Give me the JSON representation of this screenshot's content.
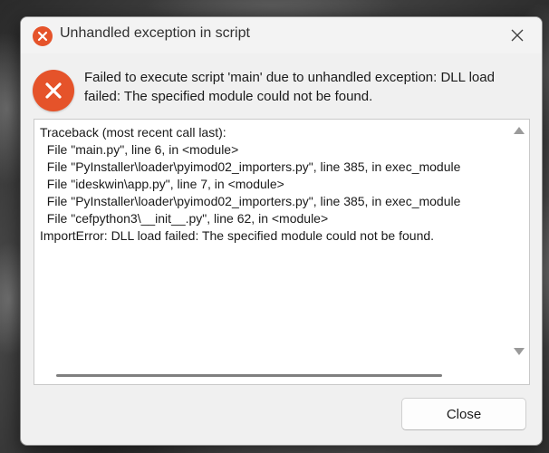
{
  "window": {
    "title": "Unhandled exception in script",
    "accent_color": "#e5532a"
  },
  "icons": {
    "title_icon": "error-icon",
    "message_icon": "error-icon",
    "close_icon": "close-icon"
  },
  "message": "Failed to execute script 'main' due to unhandled exception: DLL load failed: The specified module could not be found.",
  "traceback": {
    "lines": [
      "Traceback (most recent call last):",
      "  File \"main.py\", line 6, in <module>",
      "  File \"PyInstaller\\loader\\pyimod02_importers.py\", line 385, in exec_module",
      "  File \"ideskwin\\app.py\", line 7, in <module>",
      "  File \"PyInstaller\\loader\\pyimod02_importers.py\", line 385, in exec_module",
      "  File \"cefpython3\\__init__.py\", line 62, in <module>",
      "ImportError: DLL load failed: The specified module could not be found."
    ]
  },
  "buttons": {
    "close_label": "Close"
  }
}
